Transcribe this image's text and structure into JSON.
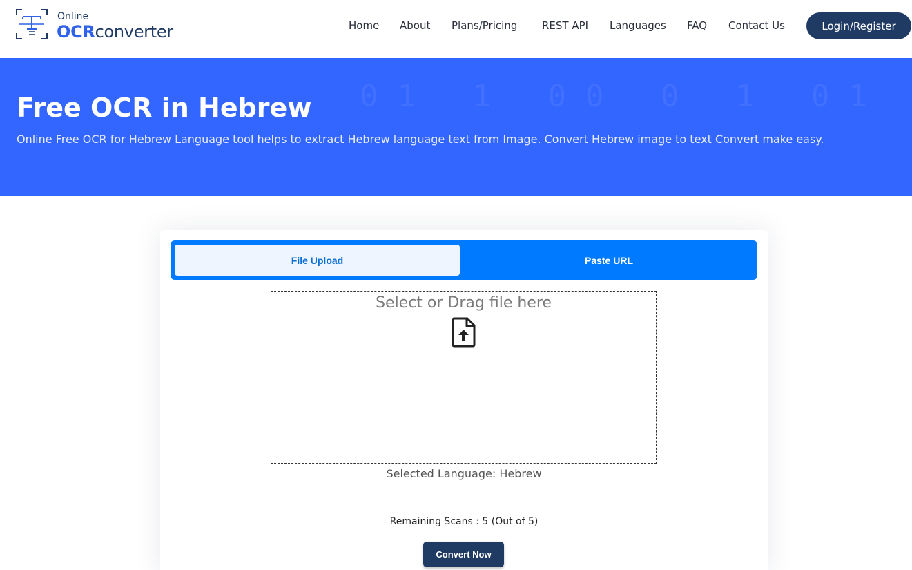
{
  "header": {
    "logo": {
      "small": "Online",
      "ocr": "OCR",
      "converter": "converter"
    },
    "nav": [
      {
        "label": "Home"
      },
      {
        "label": "About"
      },
      {
        "label": "Plans/Pricing"
      },
      {
        "label": "REST API"
      },
      {
        "label": "Languages"
      },
      {
        "label": "FAQ"
      },
      {
        "label": "Contact Us"
      }
    ],
    "login_label": "Login/Register"
  },
  "hero": {
    "title": "Free OCR in Hebrew",
    "subtitle": "Online Free OCR for Hebrew Language tool helps to extract Hebrew language text from Image. Convert Hebrew image to text Convert make easy."
  },
  "upload": {
    "tabs": [
      {
        "label": "File Upload",
        "active": true
      },
      {
        "label": "Paste URL",
        "active": false
      }
    ],
    "dropzone_text": "Select or Drag file here",
    "icon": "file-upload-icon",
    "selected_language": "Selected Language: Hebrew",
    "remaining_scans": "Remaining Scans : 5 (Out of 5)",
    "convert_label": "Convert Now"
  },
  "colors": {
    "brand_navy": "#1f3a63",
    "hero_blue": "#3366ff",
    "tab_blue": "#007bff",
    "logo_blue": "#2f62e8"
  }
}
